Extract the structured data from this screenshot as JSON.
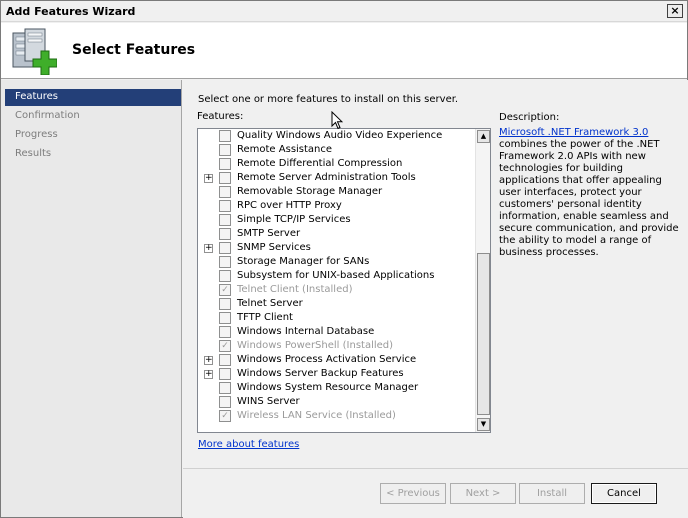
{
  "window": {
    "title": "Add Features Wizard",
    "close_glyph": "×"
  },
  "header": {
    "title": "Select Features"
  },
  "nav": {
    "items": [
      {
        "label": "Features",
        "active": true
      },
      {
        "label": "Confirmation",
        "active": false
      },
      {
        "label": "Progress",
        "active": false
      },
      {
        "label": "Results",
        "active": false
      }
    ]
  },
  "main": {
    "instruction": "Select one or more features to install on this server.",
    "features_label": "Features:",
    "features": [
      {
        "label": "Quality Windows Audio Video Experience",
        "expandable": false,
        "checked": false,
        "installed": false
      },
      {
        "label": "Remote Assistance",
        "expandable": false,
        "checked": false,
        "installed": false
      },
      {
        "label": "Remote Differential Compression",
        "expandable": false,
        "checked": false,
        "installed": false
      },
      {
        "label": "Remote Server Administration Tools",
        "expandable": true,
        "checked": false,
        "installed": false
      },
      {
        "label": "Removable Storage Manager",
        "expandable": false,
        "checked": false,
        "installed": false
      },
      {
        "label": "RPC over HTTP Proxy",
        "expandable": false,
        "checked": false,
        "installed": false
      },
      {
        "label": "Simple TCP/IP Services",
        "expandable": false,
        "checked": false,
        "installed": false
      },
      {
        "label": "SMTP Server",
        "expandable": false,
        "checked": false,
        "installed": false
      },
      {
        "label": "SNMP Services",
        "expandable": true,
        "checked": false,
        "installed": false
      },
      {
        "label": "Storage Manager for SANs",
        "expandable": false,
        "checked": false,
        "installed": false
      },
      {
        "label": "Subsystem for UNIX-based Applications",
        "expandable": false,
        "checked": false,
        "installed": false
      },
      {
        "label": "Telnet Client  (Installed)",
        "expandable": false,
        "checked": true,
        "installed": true
      },
      {
        "label": "Telnet Server",
        "expandable": false,
        "checked": false,
        "installed": false
      },
      {
        "label": "TFTP Client",
        "expandable": false,
        "checked": false,
        "installed": false
      },
      {
        "label": "Windows Internal Database",
        "expandable": false,
        "checked": false,
        "installed": false
      },
      {
        "label": "Windows PowerShell  (Installed)",
        "expandable": false,
        "checked": true,
        "installed": true
      },
      {
        "label": "Windows Process Activation Service",
        "expandable": true,
        "checked": false,
        "installed": false
      },
      {
        "label": "Windows Server Backup Features",
        "expandable": true,
        "checked": false,
        "installed": false
      },
      {
        "label": "Windows System Resource Manager",
        "expandable": false,
        "checked": false,
        "installed": false
      },
      {
        "label": "WINS Server",
        "expandable": false,
        "checked": false,
        "installed": false
      },
      {
        "label": "Wireless LAN Service  (Installed)",
        "expandable": false,
        "checked": true,
        "installed": true
      }
    ],
    "expand_glyph": "+",
    "check_glyph": "✓",
    "scroll_up_glyph": "▲",
    "scroll_down_glyph": "▼",
    "more_link": "More about features"
  },
  "description": {
    "label": "Description:",
    "link": "Microsoft .NET Framework 3.0",
    "text": "combines the power of the .NET Framework 2.0 APIs with new technologies for building applications that offer appealing user interfaces, protect your customers' personal identity information, enable seamless and secure communication, and provide the ability to model a range of business processes."
  },
  "footer": {
    "previous": "< Previous",
    "next": "Next >",
    "install": "Install",
    "cancel": "Cancel"
  },
  "colors": {
    "nav_active": "#233f78",
    "link": "#0033cc",
    "disabled_text": "#a0a0a0"
  }
}
